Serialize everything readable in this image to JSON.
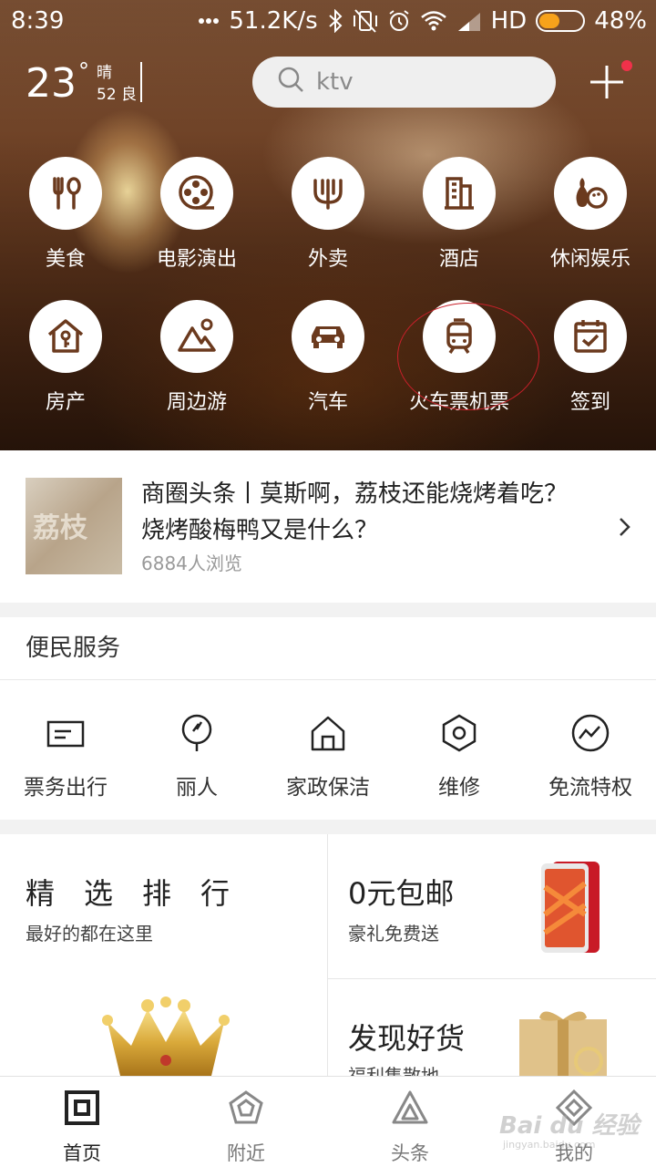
{
  "status_bar": {
    "time": "8:39",
    "network_speed": "51.2K/s",
    "network_type": "HD",
    "battery": "48%",
    "battery_level": 0.48,
    "icons": [
      "dots-icon",
      "bluetooth-icon",
      "vibrate-off-icon",
      "alarm-icon",
      "wifi-icon",
      "signal-icon",
      "battery-icon"
    ]
  },
  "weather": {
    "temperature": "23",
    "degree_symbol": "°",
    "condition": "晴",
    "aqi": "52 良"
  },
  "search": {
    "placeholder": "ktv"
  },
  "quick_grid": [
    {
      "label": "美食",
      "icon": "fork-spoon-icon"
    },
    {
      "label": "电影演出",
      "icon": "film-reel-icon"
    },
    {
      "label": "外卖",
      "icon": "takeout-icon"
    },
    {
      "label": "酒店",
      "icon": "hotel-icon"
    },
    {
      "label": "休闲娱乐",
      "icon": "bowling-icon"
    },
    {
      "label": "房产",
      "icon": "house-key-icon"
    },
    {
      "label": "周边游",
      "icon": "mountain-icon"
    },
    {
      "label": "汽车",
      "icon": "car-icon"
    },
    {
      "label": "火车票机票",
      "icon": "train-icon"
    },
    {
      "label": "签到",
      "icon": "calendar-check-icon"
    }
  ],
  "news": {
    "title": "商圈头条丨莫斯啊，荔枝还能烧烤着吃？烧烤酸梅鸭又是什么？",
    "views": "6884人浏览",
    "thumb_text": "荔枝"
  },
  "services": {
    "header": "便民服务",
    "items": [
      {
        "label": "票务出行",
        "icon": "ticket-icon"
      },
      {
        "label": "丽人",
        "icon": "mirror-icon"
      },
      {
        "label": "家政保洁",
        "icon": "home-icon"
      },
      {
        "label": "维修",
        "icon": "hex-nut-icon"
      },
      {
        "label": "免流特权",
        "icon": "wave-circle-icon"
      }
    ]
  },
  "promo": {
    "ranking": {
      "title": "精　选　排　行",
      "subtitle": "最好的都在这里"
    },
    "free_shipping": {
      "title": "0元包邮",
      "subtitle": "豪礼免费送"
    },
    "discover": {
      "title": "发现好货",
      "subtitle": "福利集散地"
    }
  },
  "tabbar": [
    {
      "label": "首页",
      "icon": "home-square-icon",
      "active": true
    },
    {
      "label": "附近",
      "icon": "pentagon-icon",
      "active": false
    },
    {
      "label": "头条",
      "icon": "triangle-icon",
      "active": false
    },
    {
      "label": "我的",
      "icon": "diamond-icon",
      "active": false
    }
  ],
  "watermark": {
    "text": "Bai du 经验",
    "sub": "jingyan.baidu.com"
  },
  "colors": {
    "accent": "#f7a21b",
    "badge": "#f0314a",
    "icon_brown": "#6b3a1e",
    "annotation": "#c8202a"
  }
}
